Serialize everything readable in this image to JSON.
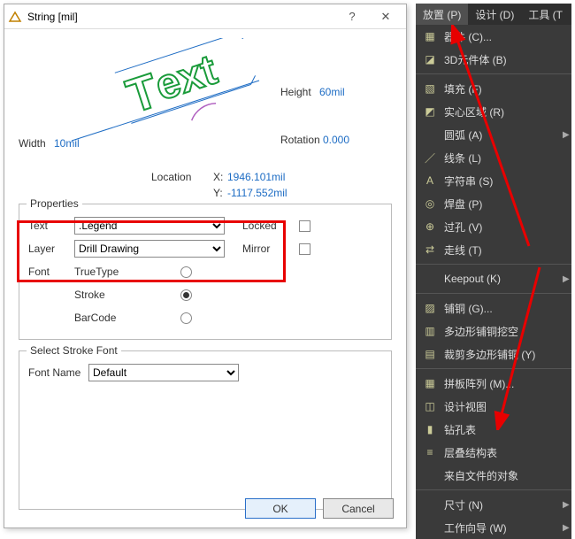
{
  "dialog": {
    "title": "String  [mil]",
    "preview": {
      "width_label": "Width",
      "width_value": "10mil",
      "height_label": "Height",
      "height_value": "60mil",
      "rotation_label": "Rotation",
      "rotation_value": "0.000",
      "location_label": "Location",
      "x_label": "X:",
      "x_value": "1946.101mil",
      "y_label": "Y:",
      "y_value": "-1117.552mil",
      "sample_text": "Text"
    },
    "props": {
      "group_title": "Properties",
      "text_label": "Text",
      "text_value": ".Legend",
      "layer_label": "Layer",
      "layer_value": "Drill Drawing",
      "locked_label": "Locked",
      "locked_value": false,
      "mirror_label": "Mirror",
      "mirror_value": false,
      "font_label": "Font",
      "font_truetype": "TrueType",
      "font_stroke": "Stroke",
      "font_barcode": "BarCode",
      "font_selected": "Stroke"
    },
    "stroke": {
      "group_title": "Select Stroke Font",
      "fontname_label": "Font Name",
      "fontname_value": "Default"
    },
    "buttons": {
      "ok": "OK",
      "cancel": "Cancel"
    }
  },
  "menu": {
    "tabs": [
      {
        "label": "放置 (P)",
        "active": true
      },
      {
        "label": "设计 (D)",
        "active": false
      },
      {
        "label": "工具 (T",
        "active": false
      }
    ],
    "items": [
      {
        "icon": "chip-icon",
        "label": "器件 (C)..."
      },
      {
        "icon": "cube-icon",
        "label": "3D元件体 (B)"
      },
      {
        "sep": true
      },
      {
        "icon": "fill-icon",
        "label": "填充 (F)"
      },
      {
        "icon": "region-icon",
        "label": "实心区域 (R)"
      },
      {
        "icon": "",
        "label": "圆弧 (A)",
        "sub": true
      },
      {
        "icon": "line-icon",
        "label": "线条 (L)"
      },
      {
        "icon": "text-icon",
        "label": "字符串 (S)"
      },
      {
        "icon": "pad-icon",
        "label": "焊盘 (P)"
      },
      {
        "icon": "via-icon",
        "label": "过孔 (V)"
      },
      {
        "icon": "track-icon",
        "label": "走线 (T)"
      },
      {
        "sep": true
      },
      {
        "icon": "",
        "label": "Keepout (K)",
        "sub": true
      },
      {
        "sep": true
      },
      {
        "icon": "pour-icon",
        "label": "铺铜 (G)..."
      },
      {
        "icon": "poly-icon",
        "label": "多边形铺铜挖空"
      },
      {
        "icon": "cut-icon",
        "label": "裁剪多边形铺铜 (Y)"
      },
      {
        "sep": true
      },
      {
        "icon": "array-icon",
        "label": "拼板阵列 (M)..."
      },
      {
        "icon": "view-icon",
        "label": "设计视图"
      },
      {
        "icon": "drill-icon",
        "label": "钻孔表"
      },
      {
        "icon": "stack-icon",
        "label": "层叠结构表"
      },
      {
        "icon": "",
        "label": "来自文件的对象"
      },
      {
        "sep": true
      },
      {
        "icon": "",
        "label": "尺寸 (N)",
        "sub": true
      },
      {
        "icon": "",
        "label": "工作向导 (W)",
        "sub": true
      }
    ]
  }
}
